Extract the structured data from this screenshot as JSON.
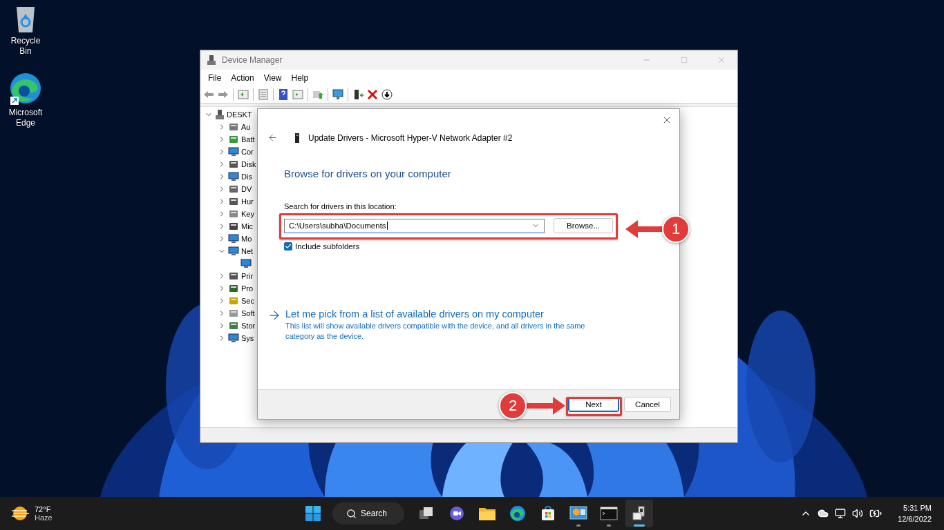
{
  "desktop_icons": [
    {
      "kind": "recycle-bin",
      "label": "Recycle Bin"
    },
    {
      "kind": "edge",
      "label": "Microsoft Edge"
    }
  ],
  "device_manager": {
    "title": "Device Manager",
    "menu": [
      "File",
      "Action",
      "View",
      "Help"
    ],
    "tree": {
      "label": "DESKT",
      "expanded": true,
      "children": [
        {
          "kind": "audio",
          "label": "Au",
          "expanded": false
        },
        {
          "kind": "battery",
          "label": "Batt",
          "expanded": false
        },
        {
          "kind": "computer",
          "label": "Cor",
          "expanded": false
        },
        {
          "kind": "disk",
          "label": "Disk",
          "expanded": false
        },
        {
          "kind": "display",
          "label": "Dis",
          "expanded": false
        },
        {
          "kind": "dvd",
          "label": "DV",
          "expanded": false
        },
        {
          "kind": "hid",
          "label": "Hur",
          "expanded": false
        },
        {
          "kind": "keyboard",
          "label": "Key",
          "expanded": false
        },
        {
          "kind": "mouse",
          "label": "Mic",
          "expanded": false
        },
        {
          "kind": "monitor",
          "label": "Mo",
          "expanded": false
        },
        {
          "kind": "network",
          "label": "Net",
          "expanded": true,
          "children": [
            {
              "kind": "network"
            }
          ]
        },
        {
          "kind": "printer",
          "label": "Prir",
          "expanded": false
        },
        {
          "kind": "processor",
          "label": "Pro",
          "expanded": false
        },
        {
          "kind": "security",
          "label": "Sec",
          "expanded": false
        },
        {
          "kind": "software",
          "label": "Soft",
          "expanded": false
        },
        {
          "kind": "storage",
          "label": "Stor",
          "expanded": false
        },
        {
          "kind": "system",
          "label": "Sys",
          "expanded": false
        }
      ]
    }
  },
  "dialog": {
    "title": "Update Drivers - Microsoft Hyper-V Network Adapter #2",
    "heading": "Browse for drivers on your computer",
    "location_label": "Search for drivers in this location:",
    "path": "C:\\Users\\subha\\Documents",
    "browse": "Browse...",
    "include_subfolders": {
      "label": "Include subfolders",
      "checked": true
    },
    "link": {
      "title": "Let me pick from a list of available drivers on my computer",
      "description": "This list will show available drivers compatible with the device, and all drivers in the same category as the device."
    },
    "buttons": [
      {
        "label": "Next",
        "default": true
      },
      {
        "label": "Cancel",
        "default": false
      }
    ]
  },
  "annotations": [
    {
      "label": "1"
    },
    {
      "label": "2"
    }
  ],
  "taskbar": {
    "weather": {
      "temp": "72°F",
      "condition": "Haze"
    },
    "search": "Search",
    "apps": [
      {
        "kind": "task-view",
        "running": false,
        "active": false
      },
      {
        "kind": "chat",
        "running": false,
        "active": false
      },
      {
        "kind": "explorer",
        "running": false,
        "active": false
      },
      {
        "kind": "edge",
        "running": false,
        "active": false
      },
      {
        "kind": "store",
        "running": false,
        "active": false
      },
      {
        "kind": "control-panel",
        "running": true,
        "active": false
      },
      {
        "kind": "terminal",
        "running": true,
        "active": false
      },
      {
        "kind": "device-manager",
        "running": true,
        "active": true
      }
    ],
    "clock": {
      "time": "5:31 PM",
      "date": "12/6/2022"
    }
  }
}
